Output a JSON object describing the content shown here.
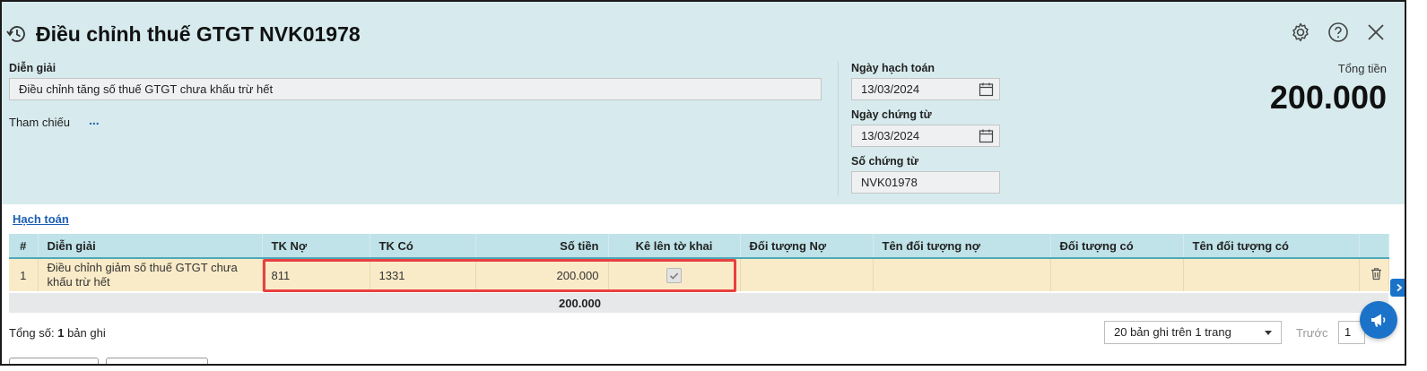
{
  "header": {
    "title": "Điều chỉnh thuế GTGT NVK01978",
    "total_label": "Tổng tiền",
    "total_value": "200.000"
  },
  "form": {
    "description_label": "Diễn giải",
    "description_value": "Điều chỉnh tăng số thuế GTGT chưa khấu trừ hết",
    "reference_label": "Tham chiếu",
    "reference_more": "...",
    "posting_date_label": "Ngày hạch toán",
    "posting_date_value": "13/03/2024",
    "voucher_date_label": "Ngày chứng từ",
    "voucher_date_value": "13/03/2024",
    "voucher_no_label": "Số chứng từ",
    "voucher_no_value": "NVK01978"
  },
  "tab": {
    "label": "Hạch toán"
  },
  "table": {
    "columns": [
      "#",
      "Diễn giải",
      "TK Nợ",
      "TK Có",
      "Số tiền",
      "Kê lên tờ khai",
      "Đối tượng Nợ",
      "Tên đối tượng nợ",
      "Đối tượng có",
      "Tên đối tượng có"
    ],
    "rows": [
      {
        "index": "1",
        "description": "Điều chỉnh giảm số thuế GTGT chưa khấu trừ hết",
        "debit_account": "811",
        "credit_account": "1331",
        "amount": "200.000",
        "declared": true,
        "debit_object": "",
        "debit_object_name": "",
        "credit_object": "",
        "credit_object_name": ""
      }
    ],
    "sum_amount": "200.000"
  },
  "footer": {
    "total_prefix": "Tổng số:",
    "total_count": "1",
    "total_suffix": "bản ghi",
    "page_size": "20 bản ghi trên 1 trang",
    "prev_label": "Trước",
    "page_number": "1"
  },
  "colors": {
    "header_bg": "#d7ebee",
    "table_header_bg": "#bfe3e8",
    "row_bg": "#faebc8",
    "accent_blue": "#1a73c9",
    "highlight_red": "#e84040"
  }
}
